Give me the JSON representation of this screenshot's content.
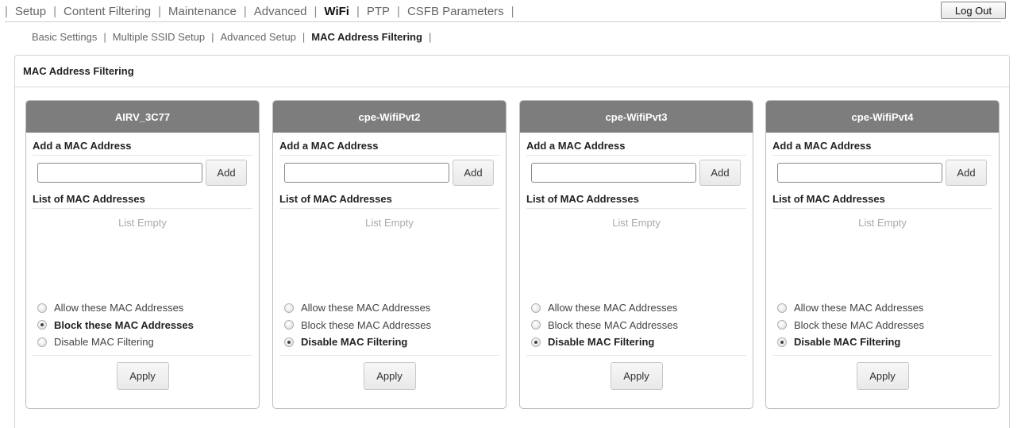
{
  "top_nav": {
    "items": [
      {
        "label": "Setup",
        "active": false
      },
      {
        "label": "Content Filtering",
        "active": false
      },
      {
        "label": "Maintenance",
        "active": false
      },
      {
        "label": "Advanced",
        "active": false
      },
      {
        "label": "WiFi",
        "active": true
      },
      {
        "label": "PTP",
        "active": false
      },
      {
        "label": "CSFB Parameters",
        "active": false
      }
    ],
    "separator": "|",
    "logout_label": "Log Out"
  },
  "sub_nav": {
    "items": [
      {
        "label": "Basic Settings",
        "active": false
      },
      {
        "label": "Multiple SSID Setup",
        "active": false
      },
      {
        "label": "Advanced Setup",
        "active": false
      },
      {
        "label": "MAC Address Filtering",
        "active": true
      }
    ],
    "separator": "|"
  },
  "panel": {
    "title": "MAC Address Filtering"
  },
  "cards": [
    {
      "ssid": "AIRV_3C77",
      "add_label": "Add a MAC Address",
      "input_value": "",
      "add_button": "Add",
      "list_label": "List of MAC Addresses",
      "list_empty": "List Empty",
      "options": [
        "Allow these MAC Addresses",
        "Block these MAC Addresses",
        "Disable MAC Filtering"
      ],
      "selected": 1,
      "apply_button": "Apply"
    },
    {
      "ssid": "cpe-WifiPvt2",
      "add_label": "Add a MAC Address",
      "input_value": "",
      "add_button": "Add",
      "list_label": "List of MAC Addresses",
      "list_empty": "List Empty",
      "options": [
        "Allow these MAC Addresses",
        "Block these MAC Addresses",
        "Disable MAC Filtering"
      ],
      "selected": 2,
      "apply_button": "Apply"
    },
    {
      "ssid": "cpe-WifiPvt3",
      "add_label": "Add a MAC Address",
      "input_value": "",
      "add_button": "Add",
      "list_label": "List of MAC Addresses",
      "list_empty": "List Empty",
      "options": [
        "Allow these MAC Addresses",
        "Block these MAC Addresses",
        "Disable MAC Filtering"
      ],
      "selected": 2,
      "apply_button": "Apply"
    },
    {
      "ssid": "cpe-WifiPvt4",
      "add_label": "Add a MAC Address",
      "input_value": "",
      "add_button": "Add",
      "list_label": "List of MAC Addresses",
      "list_empty": "List Empty",
      "options": [
        "Allow these MAC Addresses",
        "Block these MAC Addresses",
        "Disable MAC Filtering"
      ],
      "selected": 2,
      "apply_button": "Apply"
    }
  ]
}
